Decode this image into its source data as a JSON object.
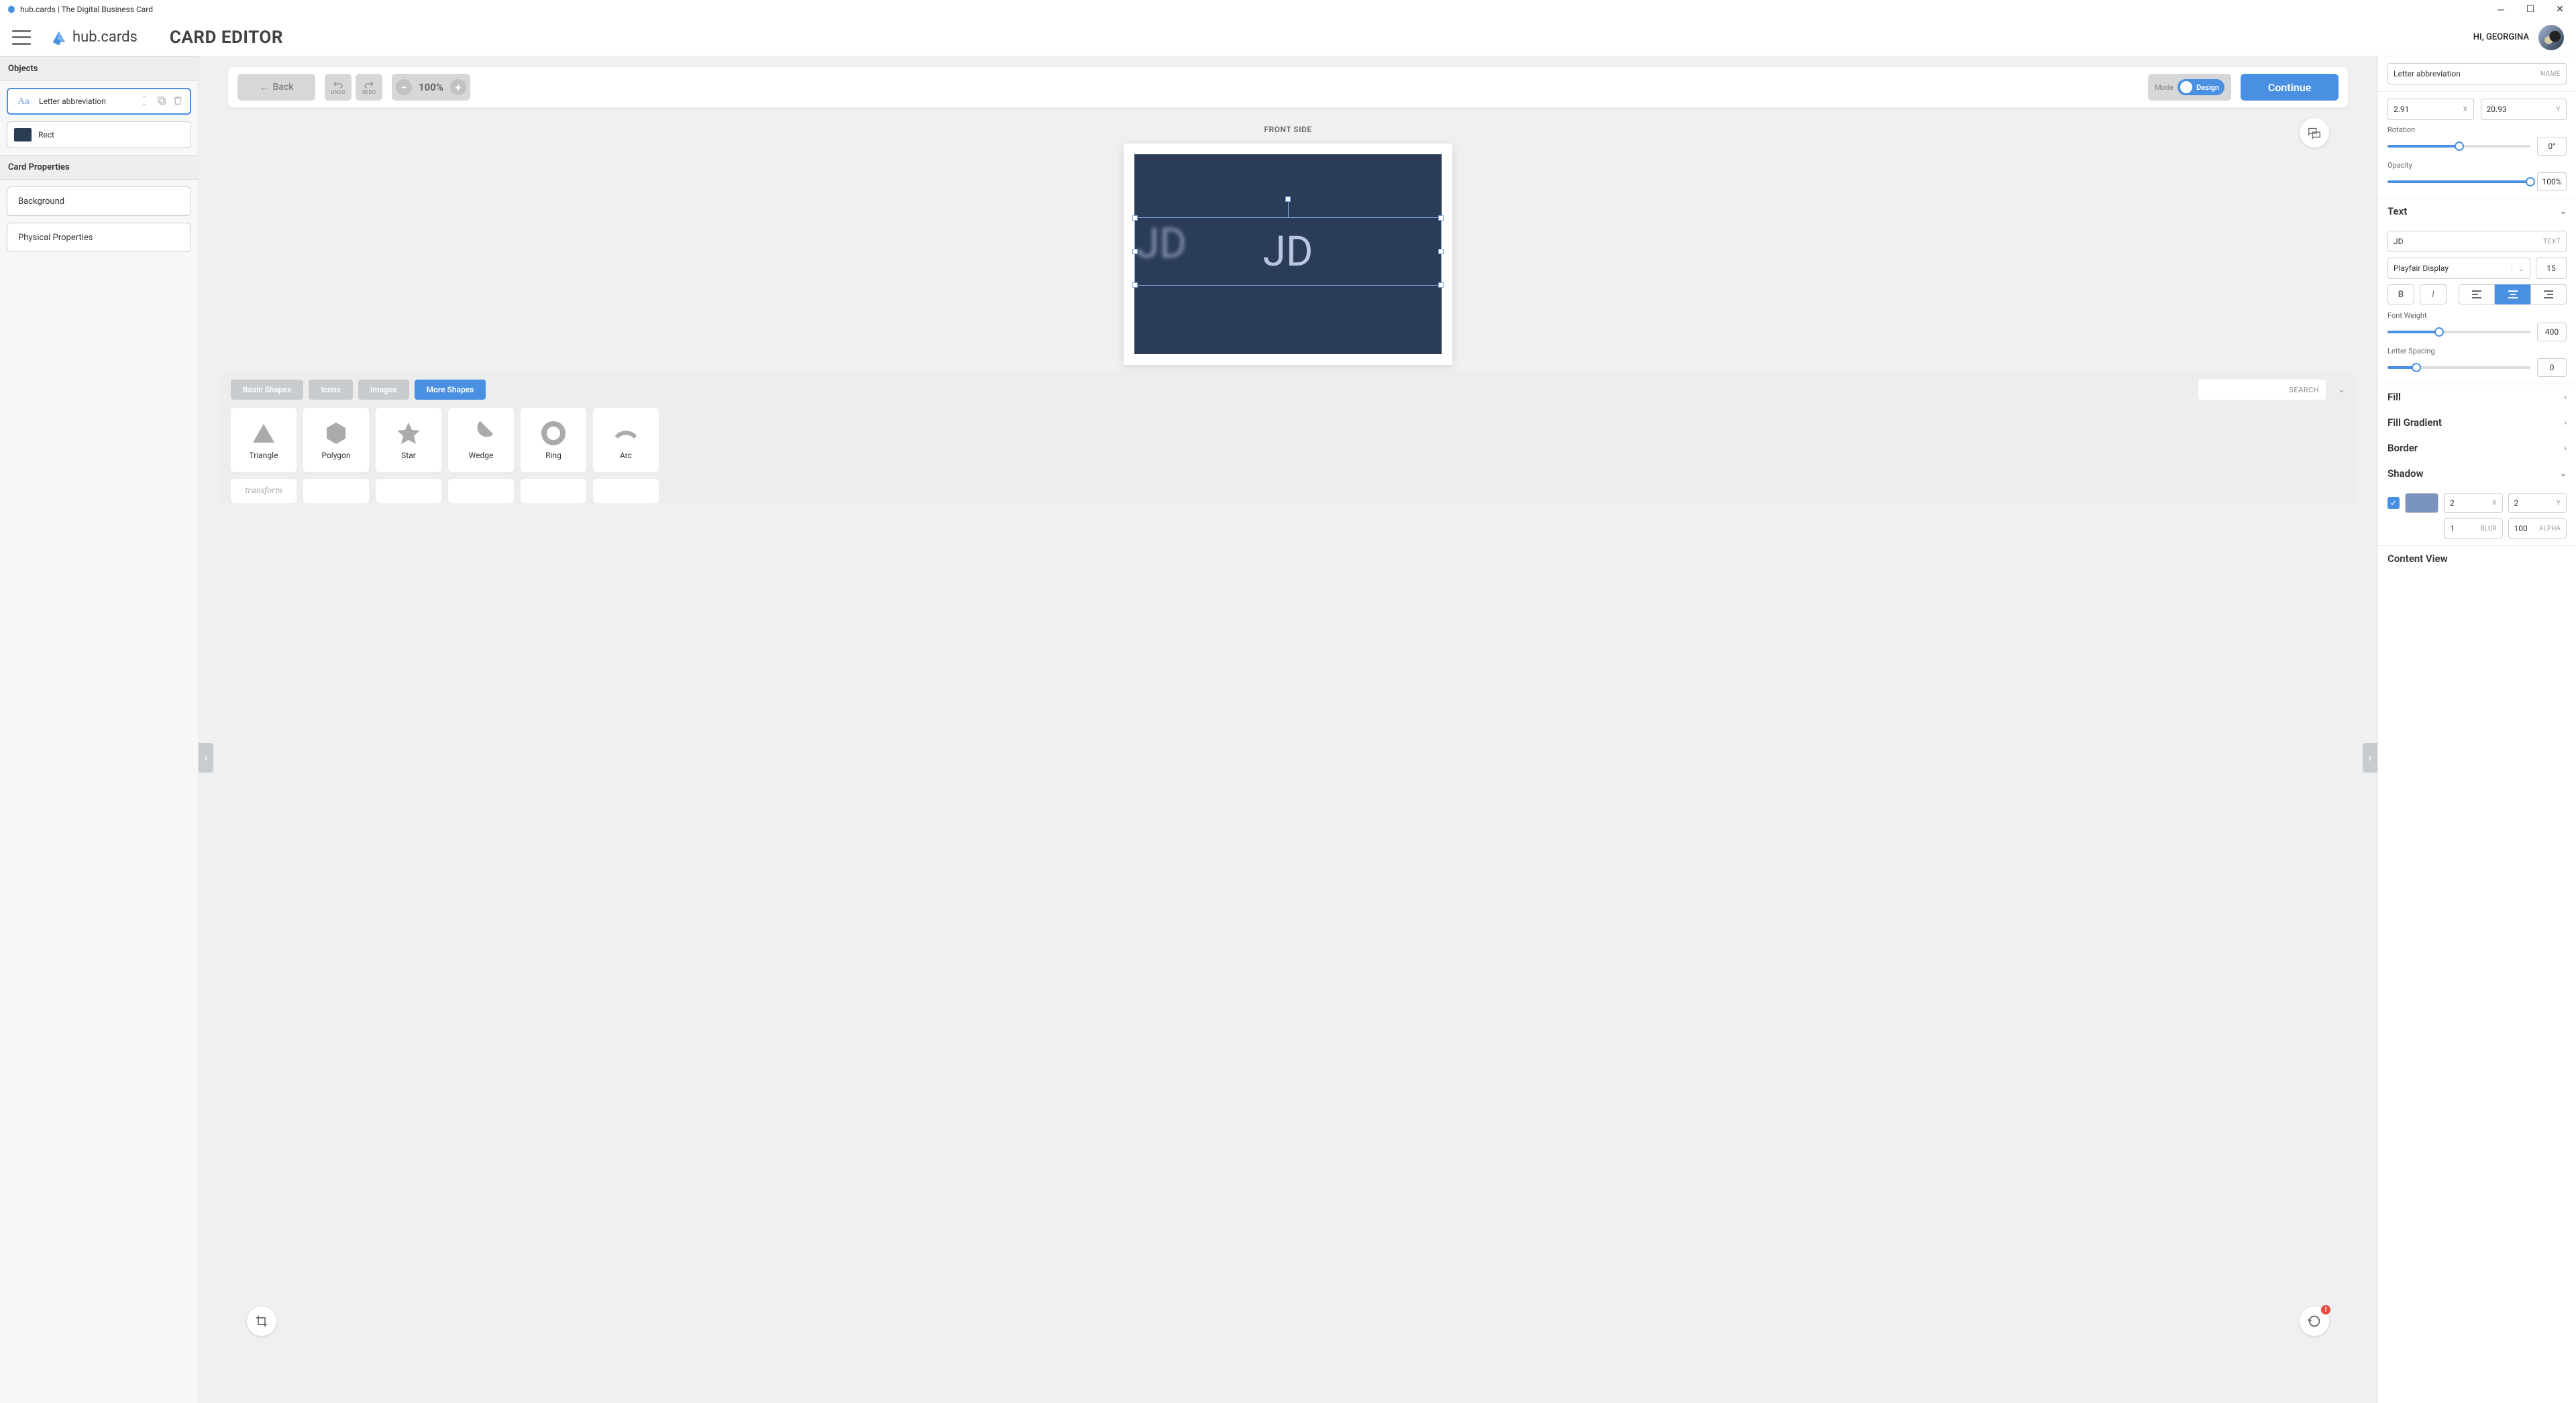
{
  "titlebar": {
    "text": "hub.cards | The Digital Business Card"
  },
  "brand": {
    "name": "hub.cards"
  },
  "page_title": "CARD EDITOR",
  "greeting": "HI, GEORGINA",
  "left": {
    "objects_header": "Objects",
    "items": [
      {
        "label": "Letter abbreviation",
        "type": "text",
        "selected": true
      },
      {
        "label": "Rect",
        "type": "rect",
        "selected": false
      }
    ],
    "props_header": "Card Properties",
    "props": [
      {
        "label": "Background"
      },
      {
        "label": "Physical Properties"
      }
    ]
  },
  "toolbar": {
    "back": "Back",
    "undo": "UNDO",
    "redo": "REDO",
    "zoom": "100%",
    "mode_label": "Mode",
    "design_label": "Design",
    "continue": "Continue"
  },
  "canvas": {
    "side_label": "FRONT SIDE",
    "text": "JD",
    "bg_color": "#2b3c58"
  },
  "tray": {
    "tabs": [
      {
        "label": "Basic Shapes"
      },
      {
        "label": "Icons"
      },
      {
        "label": "Images"
      },
      {
        "label": "More Shapes",
        "active": true
      }
    ],
    "search_label": "SEARCH",
    "shapes": [
      {
        "name": "Triangle"
      },
      {
        "name": "Polygon"
      },
      {
        "name": "Star"
      },
      {
        "name": "Wedge"
      },
      {
        "name": "Ring"
      },
      {
        "name": "Arc"
      }
    ],
    "row2": {
      "label": "transform"
    }
  },
  "right": {
    "name": {
      "value": "Letter abbreviation",
      "label": "NAME"
    },
    "x": {
      "value": "2.91",
      "label": "X"
    },
    "y": {
      "value": "20.93",
      "label": "Y"
    },
    "rotation": {
      "label": "Rotation",
      "value": "0°",
      "pct": 50
    },
    "opacity": {
      "label": "Opacity",
      "value": "100%",
      "pct": 100
    },
    "text_header": "Text",
    "text": {
      "value": "JD",
      "label": "TEXT"
    },
    "font": {
      "family": "Playfair Display",
      "size": "15"
    },
    "weight": {
      "label": "Font Weight",
      "value": "400",
      "pct": 36
    },
    "spacing": {
      "label": "Letter Spacing",
      "value": "0",
      "pct": 20
    },
    "panels": {
      "fill": "Fill",
      "fill_gradient": "Fill Gradient",
      "border": "Border",
      "shadow": "Shadow"
    },
    "shadow": {
      "color": "#7a93bd",
      "x": {
        "value": "2",
        "label": "X"
      },
      "y": {
        "value": "2",
        "label": "Y"
      },
      "blur": {
        "value": "1",
        "label": "BLUR"
      },
      "alpha": {
        "value": "100",
        "label": "ALPHA"
      }
    },
    "content_view": "Content View"
  }
}
